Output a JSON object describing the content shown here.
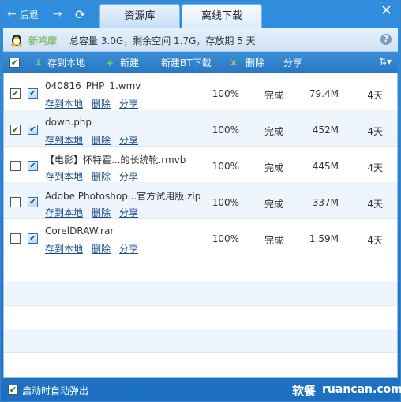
{
  "nav": {
    "back_label": "后退"
  },
  "tabs": [
    {
      "label": "资源库"
    },
    {
      "label": "离线下载"
    }
  ],
  "info": {
    "username": "新鸣摩",
    "summary": "总容量 3.0G，剩余空间 1.7G，存放期 5 天"
  },
  "toolbar": {
    "save_local": "存到本地",
    "new": "新建",
    "new_bt": "新建BT下载",
    "delete": "删除",
    "share": "分享"
  },
  "actions": {
    "save_local": "存到本地",
    "delete": "删除",
    "share": "分享"
  },
  "rows": [
    {
      "name": "040816_PHP_1.wmv",
      "progress": "100%",
      "status": "完成",
      "size": "79.4M",
      "days": "4天",
      "checked": true
    },
    {
      "name": "down.php",
      "progress": "100%",
      "status": "完成",
      "size": "452M",
      "days": "4天",
      "checked": true
    },
    {
      "name": "【电影】怀特霍...的长统靴.rmvb",
      "progress": "100%",
      "status": "完成",
      "size": "445M",
      "days": "4天",
      "checked": false
    },
    {
      "name": "Adobe Photoshop...官方试用版.zip",
      "progress": "100%",
      "status": "完成",
      "size": "337M",
      "days": "4天",
      "checked": false
    },
    {
      "name": "CorelDRAW.rar",
      "progress": "100%",
      "status": "完成",
      "size": "1.59M",
      "days": "4天",
      "checked": false
    }
  ],
  "footer": {
    "autostart_label": "启动时自动弹出",
    "watermark_cn": "软餐",
    "watermark_url": "ruancan.com"
  },
  "colors": {
    "titlebar": "#2a7fd0",
    "link": "#1a4c8d",
    "alt_row": "#eef5fd"
  }
}
